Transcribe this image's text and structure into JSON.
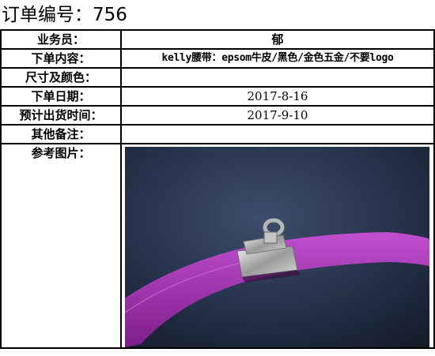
{
  "order": {
    "title": "订单编号：756"
  },
  "fields": [
    {
      "label": "业务员：",
      "value": "郁"
    },
    {
      "label": "下单内容：",
      "value": "kelly腰带：epsom牛皮/黑色/金色五金/不要logo"
    },
    {
      "label": "尺寸及颜色：",
      "value": ""
    },
    {
      "label": "下单日期：",
      "value": "2017-8-16"
    },
    {
      "label": "预计出货时间：",
      "value": "2017-9-10"
    },
    {
      "label": "其他备注：",
      "value": ""
    },
    {
      "label": "参考图片：",
      "value": ""
    }
  ],
  "image": {
    "subject": "purple leather belt with silver Kelly buckle on dark blue background",
    "colors": {
      "background": "#2b3a55",
      "belt": "#a233b0",
      "hardware": "#c9c9c9"
    }
  }
}
